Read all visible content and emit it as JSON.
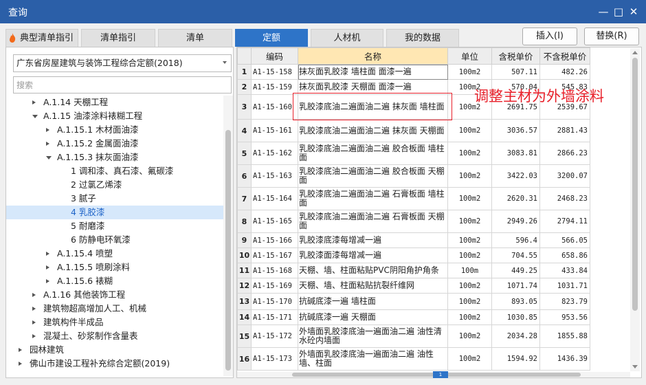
{
  "window": {
    "title": "查询",
    "minimize_glyph": "—",
    "maximize_glyph": "□",
    "close_glyph": "✕"
  },
  "tabs": [
    "典型清单指引",
    "清单指引",
    "清单",
    "定额",
    "人材机",
    "我的数据"
  ],
  "active_tab": "定额",
  "buttons": {
    "insert": "插入(I)",
    "replace": "替换(R)"
  },
  "library": {
    "selected": "广东省房屋建筑与装饰工程综合定额(2018)"
  },
  "search": {
    "placeholder": "搜索",
    "value": ""
  },
  "tree": [
    {
      "label": "A.1.14 天棚工程",
      "level": 2,
      "toggle": "collapsed"
    },
    {
      "label": "A.1.15 油漆涂料裱糊工程",
      "level": 2,
      "toggle": "expanded"
    },
    {
      "label": "A.1.15.1 木材面油漆",
      "level": 3,
      "toggle": "collapsed"
    },
    {
      "label": "A.1.15.2 金属面油漆",
      "level": 3,
      "toggle": "collapsed"
    },
    {
      "label": "A.1.15.3 抹灰面油漆",
      "level": 3,
      "toggle": "expanded"
    },
    {
      "label": "1 调和漆、真石漆、氟碳漆",
      "level": 4,
      "toggle": "none"
    },
    {
      "label": "2 过氯乙烯漆",
      "level": 4,
      "toggle": "none"
    },
    {
      "label": "3 腻子",
      "level": 4,
      "toggle": "none"
    },
    {
      "label": "4 乳胶漆",
      "level": 4,
      "toggle": "none",
      "selected": true
    },
    {
      "label": "5 耐磨漆",
      "level": 4,
      "toggle": "none"
    },
    {
      "label": "6 防静电环氧漆",
      "level": 4,
      "toggle": "none"
    },
    {
      "label": "A.1.15.4 喷塑",
      "level": 3,
      "toggle": "collapsed"
    },
    {
      "label": "A.1.15.5 喷刷涂料",
      "level": 3,
      "toggle": "collapsed"
    },
    {
      "label": "A.1.15.6 裱糊",
      "level": 3,
      "toggle": "collapsed"
    },
    {
      "label": "A.1.16 其他装饰工程",
      "level": 2,
      "toggle": "collapsed"
    },
    {
      "label": "建筑物超高增加人工、机械",
      "level": 2,
      "toggle": "collapsed"
    },
    {
      "label": "建筑构件半成品",
      "level": 2,
      "toggle": "collapsed"
    },
    {
      "label": "混凝土、砂浆制作含量表",
      "level": 2,
      "toggle": "collapsed"
    },
    {
      "label": "园林建筑",
      "level": 1,
      "toggle": "collapsed"
    },
    {
      "label": "佛山市建设工程补充综合定额(2019)",
      "level": 1,
      "toggle": "collapsed"
    }
  ],
  "table": {
    "columns": [
      "",
      "编码",
      "名称",
      "单位",
      "含税单价",
      "不含税单价"
    ],
    "rows": [
      {
        "idx": "1",
        "code": "A1-15-158",
        "name": "抹灰面乳胶漆 墙柱面 面漆一遍",
        "unit": "100m2",
        "price_tax": "507.11",
        "price_notax": "482.26"
      },
      {
        "idx": "2",
        "code": "A1-15-159",
        "name": "抹灰面乳胶漆 天棚面 面漆一遍",
        "unit": "100m2",
        "price_tax": "570.04",
        "price_notax": "545.83"
      },
      {
        "idx": "3",
        "code": "A1-15-160",
        "name": "乳胶漆底油二遍面油二遍 抹灰面 墙柱面",
        "unit": "100m2",
        "price_tax": "2691.75",
        "price_notax": "2539.67"
      },
      {
        "idx": "4",
        "code": "A1-15-161",
        "name": "乳胶漆底油二遍面油二遍 抹灰面 天棚面",
        "unit": "100m2",
        "price_tax": "3036.57",
        "price_notax": "2881.43"
      },
      {
        "idx": "5",
        "code": "A1-15-162",
        "name": "乳胶漆底油二遍面油二遍 胶合板面 墙柱面",
        "unit": "100m2",
        "price_tax": "3083.81",
        "price_notax": "2866.23"
      },
      {
        "idx": "6",
        "code": "A1-15-163",
        "name": "乳胶漆底油二遍面油二遍 胶合板面 天棚面",
        "unit": "100m2",
        "price_tax": "3422.03",
        "price_notax": "3200.07"
      },
      {
        "idx": "7",
        "code": "A1-15-164",
        "name": "乳胶漆底油二遍面油二遍 石膏板面 墙柱面",
        "unit": "100m2",
        "price_tax": "2620.31",
        "price_notax": "2468.23"
      },
      {
        "idx": "8",
        "code": "A1-15-165",
        "name": "乳胶漆底油二遍面油二遍 石膏板面 天棚面",
        "unit": "100m2",
        "price_tax": "2949.26",
        "price_notax": "2794.11"
      },
      {
        "idx": "9",
        "code": "A1-15-166",
        "name": "乳胶漆底漆每增减一遍",
        "unit": "100m2",
        "price_tax": "596.4",
        "price_notax": "566.05"
      },
      {
        "idx": "10",
        "code": "A1-15-167",
        "name": "乳胶漆面漆每增减一遍",
        "unit": "100m2",
        "price_tax": "704.55",
        "price_notax": "658.86"
      },
      {
        "idx": "11",
        "code": "A1-15-168",
        "name": "天棚、墙、柱面粘贴PVC阴阳角护角条",
        "unit": "100m",
        "price_tax": "449.25",
        "price_notax": "433.84"
      },
      {
        "idx": "12",
        "code": "A1-15-169",
        "name": "天棚、墙、柱面粘贴抗裂纤维网",
        "unit": "100m2",
        "price_tax": "1071.74",
        "price_notax": "1031.71"
      },
      {
        "idx": "13",
        "code": "A1-15-170",
        "name": "抗碱底漆一遍 墙柱面",
        "unit": "100m2",
        "price_tax": "893.05",
        "price_notax": "823.79"
      },
      {
        "idx": "14",
        "code": "A1-15-171",
        "name": "抗碱底漆一遍 天棚面",
        "unit": "100m2",
        "price_tax": "1030.85",
        "price_notax": "953.56"
      },
      {
        "idx": "15",
        "code": "A1-15-172",
        "name": "外墙面乳胶漆底油一遍面油二遍 油性清水砼内墙面",
        "unit": "100m2",
        "price_tax": "2034.28",
        "price_notax": "1855.88"
      },
      {
        "idx": "16",
        "code": "A1-15-173",
        "name": "外墙面乳胶漆底油一遍面油二遍 油性墙、柱面",
        "unit": "100m2",
        "price_tax": "1594.92",
        "price_notax": "1436.39"
      }
    ]
  },
  "annotation": "调整主材为外墙涂料",
  "scrollbar_page": "1",
  "colors": {
    "titlebar": "#2b5fa8",
    "accent": "#2e74c8",
    "header_highlight": "#ffe7b3",
    "annotation": "#e8202a",
    "selection": "#d6e8fb"
  }
}
